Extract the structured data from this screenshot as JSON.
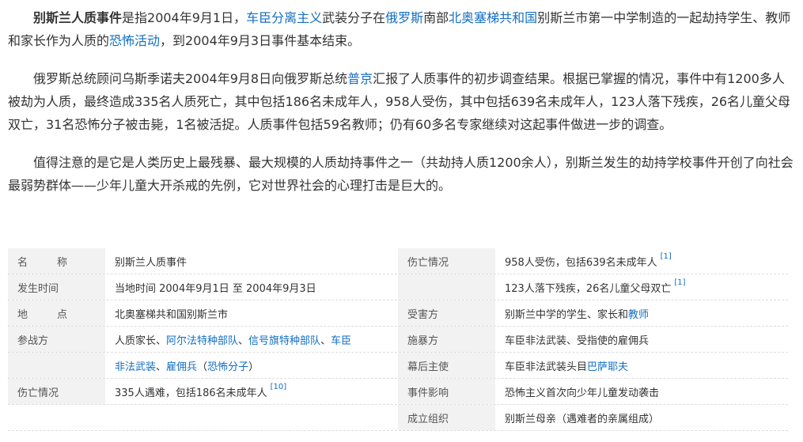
{
  "p1": {
    "bold": "别斯兰人质事件",
    "t1": "是指2004年9月1日，",
    "l1": "车臣分离主义",
    "t2": "武装分子在",
    "l2": "俄罗斯",
    "t3": "南部",
    "l3": "北奥塞梯共和国",
    "t4": "别斯兰市第一中学制造的一起劫持学生、教师和家长作为人质的",
    "l4": "恐怖活动",
    "t5": "，到2004年9月3日事件基本结束。"
  },
  "p2": {
    "t1": "俄罗斯总统顾问乌斯季诺夫2004年9月8日向俄罗斯总统",
    "l1": "普京",
    "t2": "汇报了人质事件的初步调查结果。根据已掌握的情况，事件中有1200多人被劫为人质，最终造成335名人质死亡，其中包括186名未成年人，958人受伤，其中包括639名未成年人，123人落下残疾，26名儿童父母双亡，31名恐怖分子被击毙，1名被活捉。人质事件包括59名教师；仍有60多名专家继续对这起事件做进一步的调查。"
  },
  "p3": {
    "t1": "值得注意的是它是人类历史上最残暴、最大规模的人质劫持事件之一（共劫持人质1200余人），别斯兰发生的劫持学校事件开创了向社会最弱势群体——少年儿童大开杀戒的先例，它对世界社会的心理打击是巨大的。"
  },
  "info": {
    "name_k": "名　称",
    "name_v": "别斯兰人质事件",
    "time_k": "发生时间",
    "time_v": "当地时间 2004年9月1日 至 2004年9月3日",
    "place_k": "地　点",
    "place_v": "北奥塞梯共和国别斯兰市",
    "party_k": "参战方",
    "party_v1": "人质家长、",
    "party_l1": "阿尔法特种部队",
    "party_s1": "、",
    "party_l2": "信号旗特种部队",
    "party_s2": "、",
    "party_l3": "车臣",
    "party_l4": "非法武装",
    "party_s3": "、",
    "party_l5": "雇佣兵",
    "party_s4": "（",
    "party_l6": "恐怖分子",
    "party_s5": "）",
    "casualty_k": "伤亡情况",
    "casualty_v": "335人遇难，包括186名未成年人",
    "casualty_ref": "[10]",
    "r_casualty_k": "伤亡情况",
    "r_casualty_v1": "958人受伤，包括639名未成年人",
    "r_casualty_ref1": "[1]",
    "r_casualty_v2": "123人落下残疾，26名儿童父母双亡",
    "r_casualty_ref2": "[1]",
    "victim_k": "受害方",
    "victim_v": "别斯兰中学的学生、家长和",
    "victim_l": "教师",
    "perp_k": "施暴方",
    "perp_v": "车臣非法武装、受指使的雇佣兵",
    "master_k": "幕后主使",
    "master_v": "车臣非法武装头目",
    "master_l": "巴萨耶夫",
    "impact_k": "事件影响",
    "impact_v": "恐怖主义首次向少年儿童发动袭击",
    "org_k": "成立组织",
    "org_v": "别斯兰母亲（遇难者的亲属组成）"
  }
}
